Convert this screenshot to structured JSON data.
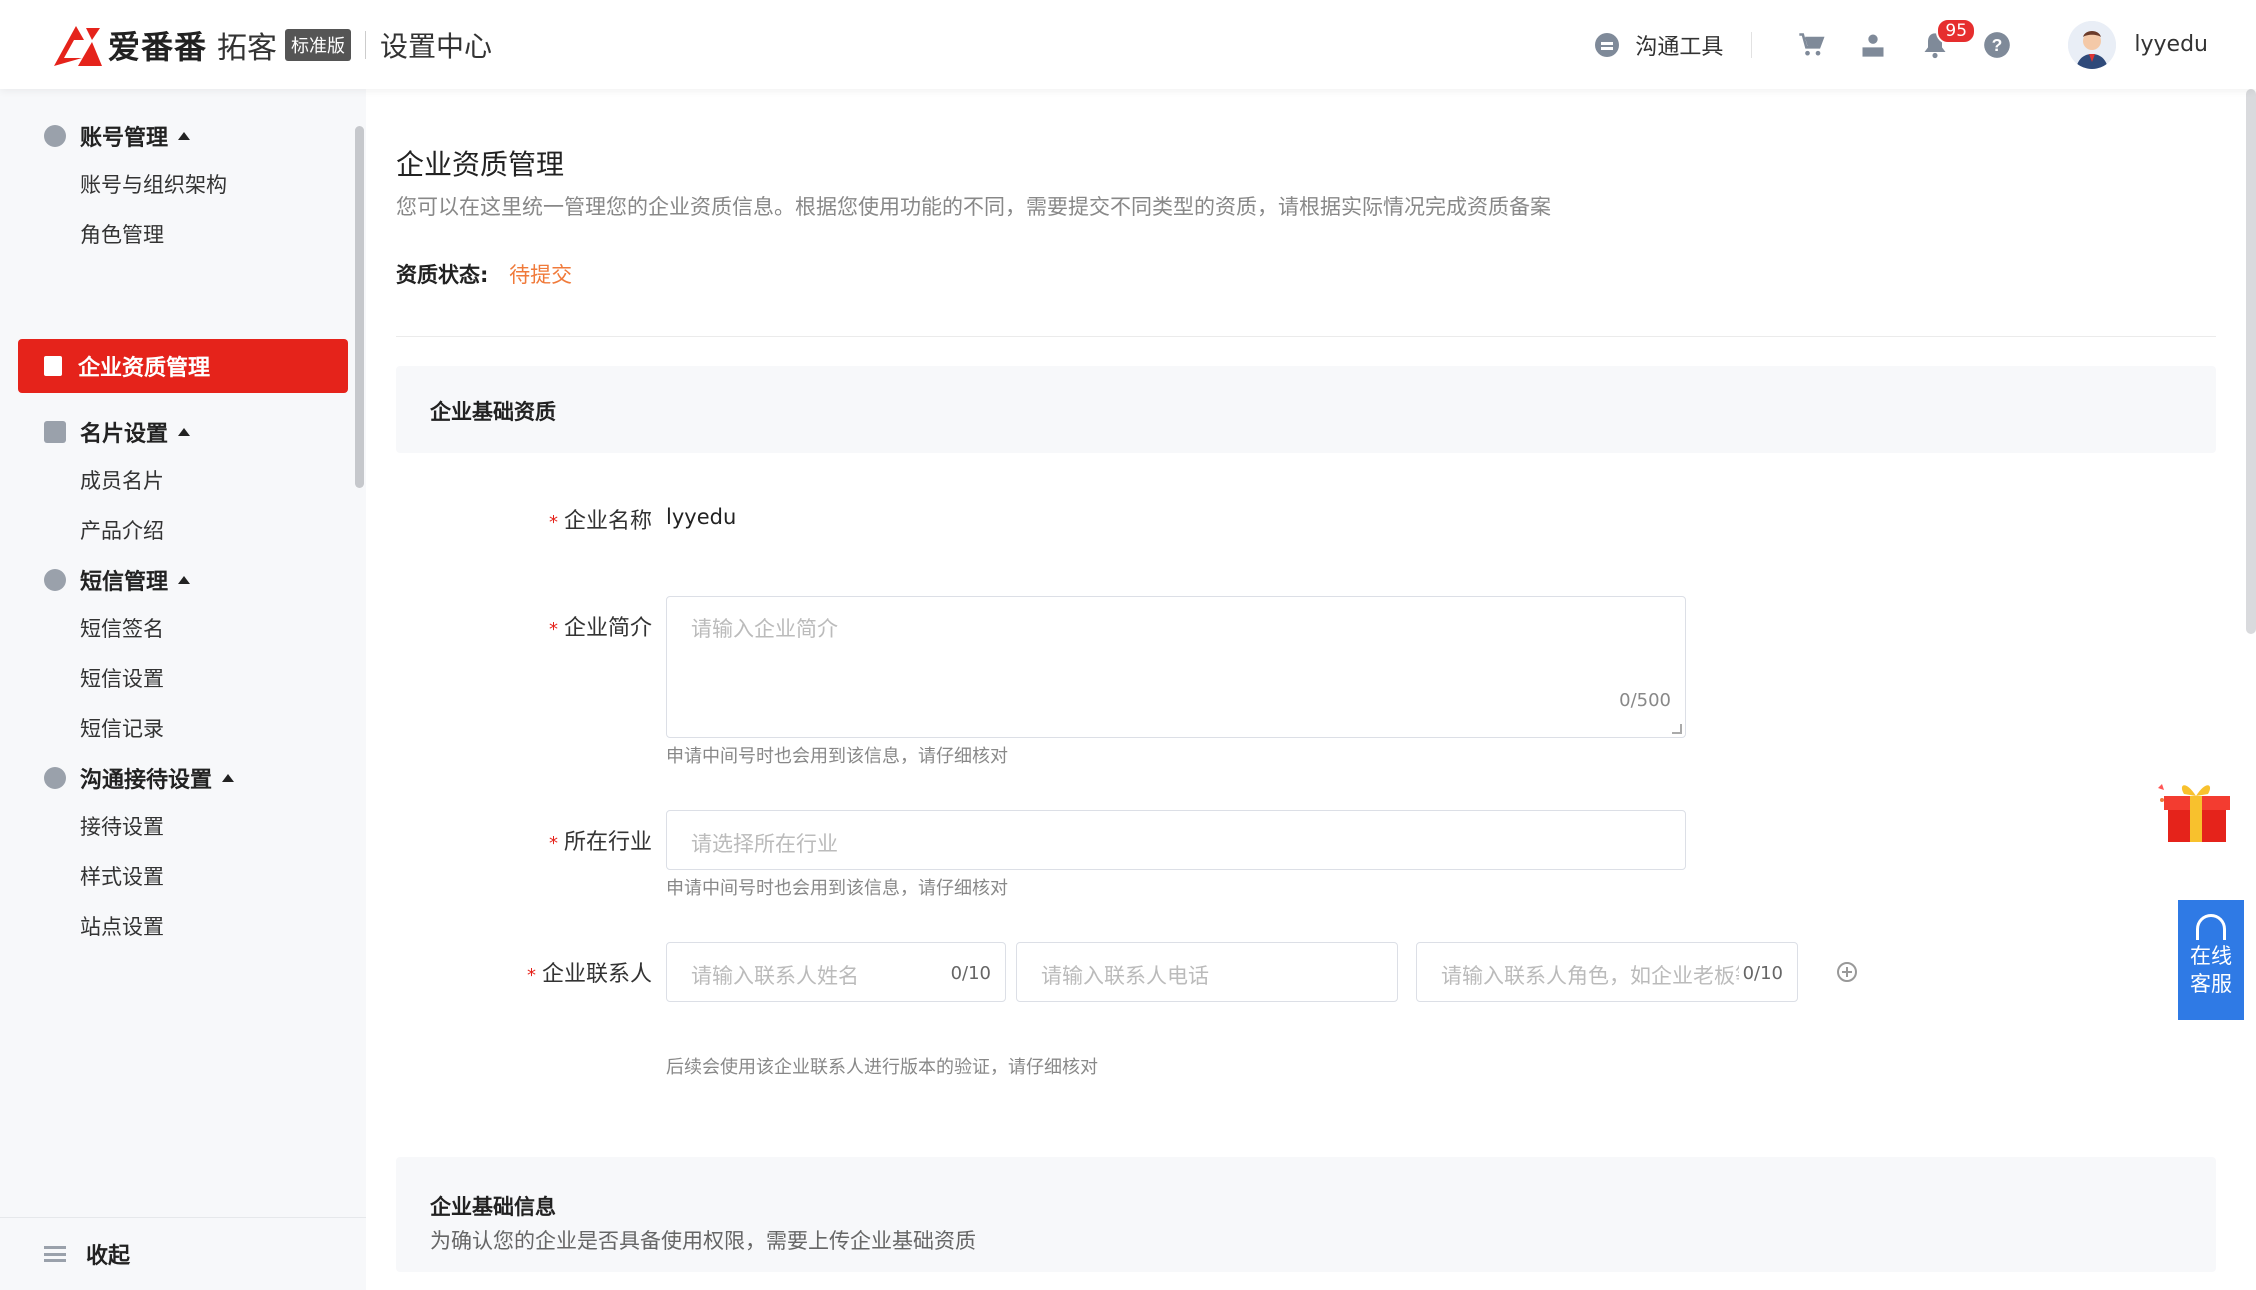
{
  "header": {
    "brand": "爱番番",
    "brand_sub": "拓客",
    "edition": "标准版",
    "section_title": "设置中心",
    "tool_label": "沟通工具",
    "notification_count": "95",
    "username": "lyyedu"
  },
  "sidebar": {
    "groups": [
      {
        "label": "账号管理",
        "items": [
          "账号与组织架构",
          "角色管理"
        ]
      },
      {
        "label": "名片设置",
        "items": [
          "成员名片",
          "产品介绍"
        ]
      },
      {
        "label": "短信管理",
        "items": [
          "短信签名",
          "短信设置",
          "短信记录"
        ]
      },
      {
        "label": "沟通接待设置",
        "items": [
          "接待设置",
          "样式设置",
          "站点设置"
        ]
      }
    ],
    "active_item": "企业资质管理",
    "collapse_label": "收起"
  },
  "page": {
    "title": "企业资质管理",
    "description": "您可以在这里统一管理您的企业资质信息。根据您使用功能的不同，需要提交不同类型的资质，请根据实际情况完成资质备案",
    "status_label": "资质状态:",
    "status_value": "待提交"
  },
  "section_basic": {
    "title": "企业基础资质"
  },
  "form": {
    "company_name": {
      "label": "企业名称",
      "value": "lyyedu"
    },
    "company_intro": {
      "label": "企业简介",
      "placeholder": "请输入企业简介",
      "counter": "0/500",
      "hint": "申请中间号时也会用到该信息，请仔细核对"
    },
    "industry": {
      "label": "所在行业",
      "placeholder": "请选择所在行业",
      "hint": "申请中间号时也会用到该信息，请仔细核对"
    },
    "contact": {
      "label": "企业联系人",
      "name_placeholder": "请输入联系人姓名",
      "name_counter": "0/10",
      "phone_placeholder": "请输入联系人电话",
      "role_placeholder": "请输入联系人角色，如企业老板等",
      "role_counter": "0/10",
      "hint": "后续会使用该企业联系人进行版本的验证，请仔细核对"
    }
  },
  "section_info": {
    "title": "企业基础信息",
    "description": "为确认您的企业是否具备使用权限，需要上传企业基础资质"
  },
  "floating": {
    "service_line1": "在线",
    "service_line2": "客服"
  },
  "colors": {
    "accent_red": "#e5231b",
    "status_orange": "#f07a3a",
    "service_blue": "#2f7ae5"
  }
}
